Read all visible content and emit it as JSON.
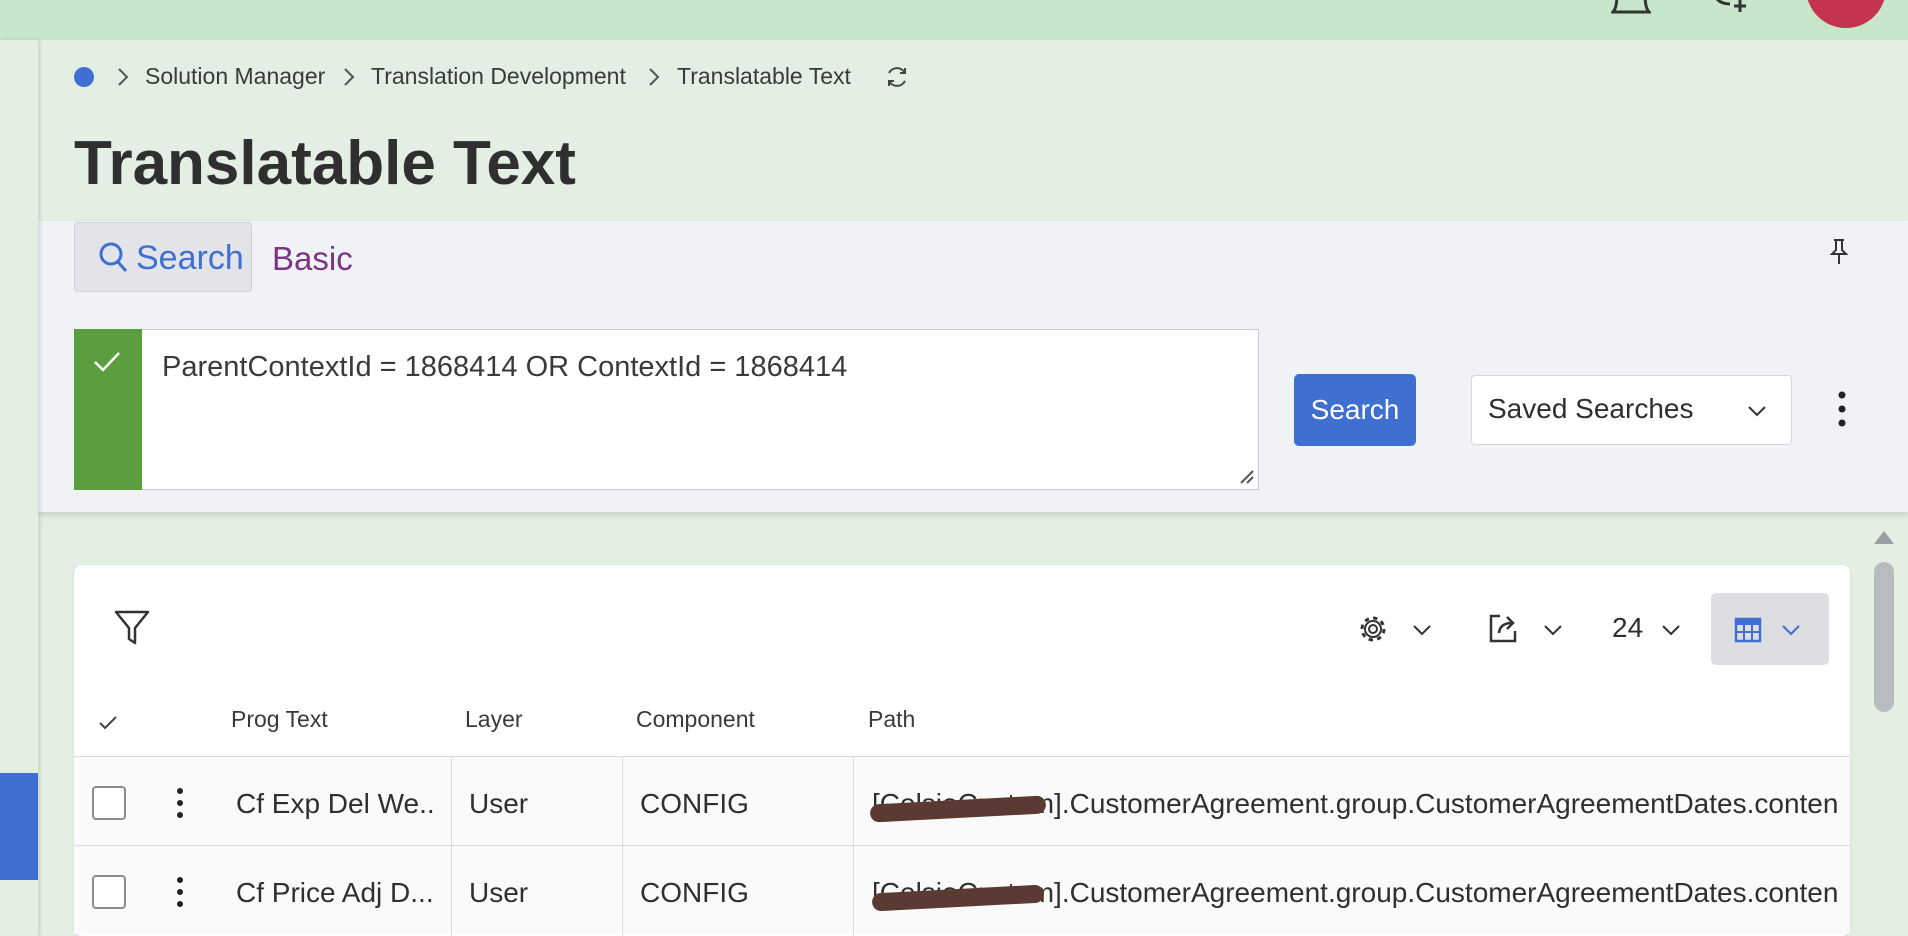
{
  "header": {
    "icons": [
      "bell-icon",
      "add-user-icon",
      "avatar"
    ]
  },
  "breadcrumb": {
    "items": [
      "Solution Manager",
      "Translation Development",
      "Translatable Text"
    ]
  },
  "page": {
    "title": "Translatable Text"
  },
  "search": {
    "tab_label": "Search",
    "basic_label": "Basic",
    "query": "ParentContextId = 1868414 OR ContextId = 1868414",
    "button_label": "Search",
    "saved_searches_label": "Saved Searches"
  },
  "grid": {
    "page_size": "24",
    "columns": [
      "Prog Text",
      "Layer",
      "Component",
      "Path"
    ],
    "rows": [
      {
        "prog_text": "Cf Exp Del We...",
        "layer": "User",
        "component": "CONFIG",
        "path": "[CelsioCustom].CustomerAgreement.group.CustomerAgreementDates.conten"
      },
      {
        "prog_text": "Cf Price Adj D...",
        "layer": "User",
        "component": "CONFIG",
        "path": "[CelsioCustom].CustomerAgreement.group.CustomerAgreementDates.conten"
      }
    ]
  },
  "colors": {
    "accent": "#3f6fd1",
    "valid": "#5a9e3d",
    "basic": "#7a3583",
    "avatar": "#c4344f",
    "header": "#c8e6c9"
  }
}
